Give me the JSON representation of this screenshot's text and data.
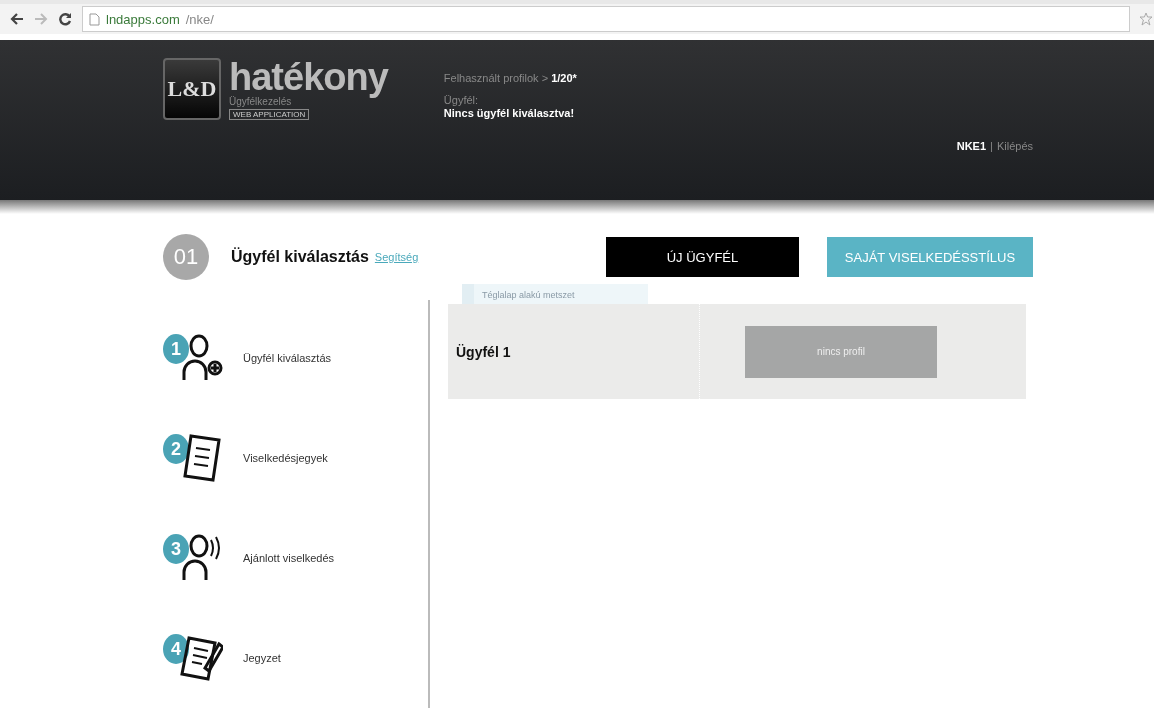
{
  "browser": {
    "url_domain": "lndapps.com",
    "url_path": "/nke/"
  },
  "header": {
    "logo_mark": "L&D",
    "brand": "hatékony",
    "tagline": "Ügyfélkezelés",
    "badge": "WEB APPLICATION",
    "profiles_label": "Felhasznált profilok >",
    "profiles_count": "1/20*",
    "client_label": "Ügyfél:",
    "client_value": "Nincs ügyfél kiválasztva!",
    "user": "NKE1",
    "separator": "|",
    "logout": "Kilépés"
  },
  "step": {
    "number": "01",
    "title": "Ügyfél kiválasztás",
    "help": "Segítség"
  },
  "buttons": [
    {
      "label": "ÚJ ÜGYFÉL",
      "kind": "dark"
    },
    {
      "label": "SAJÁT VISELKEDÉSSTÍLUS",
      "kind": "accent"
    }
  ],
  "tooltip": "Téglalap alakú metszet",
  "steps": [
    {
      "number": "1",
      "label": "Ügyfél kiválasztás",
      "kind": "person-add"
    },
    {
      "number": "2",
      "label": "Viselkedésjegyek",
      "kind": "checklist"
    },
    {
      "number": "3",
      "label": "Ajánlott viselkedés",
      "kind": "person-speak"
    },
    {
      "number": "4",
      "label": "Jegyzet",
      "kind": "note"
    }
  ],
  "clients": [
    {
      "name": "Ügyfél 1",
      "profile": "nincs profil"
    }
  ]
}
